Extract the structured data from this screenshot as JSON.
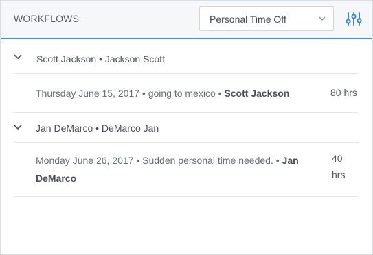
{
  "header": {
    "title": "WORKFLOWS",
    "select": {
      "value": "Personal Time Off"
    },
    "accent_color": "#4a90d9"
  },
  "groups": [
    {
      "name": "Scott Jackson • Jackson Scott",
      "entry": {
        "date": "Thursday June 15, 2017",
        "sep1": " • ",
        "reason": "going to mexico",
        "sep2": " • ",
        "person": "Scott Jackson",
        "hours": "80 hrs"
      }
    },
    {
      "name": "Jan DeMarco • DeMarco Jan",
      "entry": {
        "date": "Monday June 26, 2017",
        "sep1": " • ",
        "reason": "Sudden personal time needed.",
        "sep2": " • ",
        "person": "Jan DeMarco",
        "hours": "40 hrs"
      }
    }
  ],
  "icons": {
    "dropdown": "chevron-down-icon",
    "filter": "sliders-icon",
    "group_toggle": "chevron-down-icon"
  }
}
